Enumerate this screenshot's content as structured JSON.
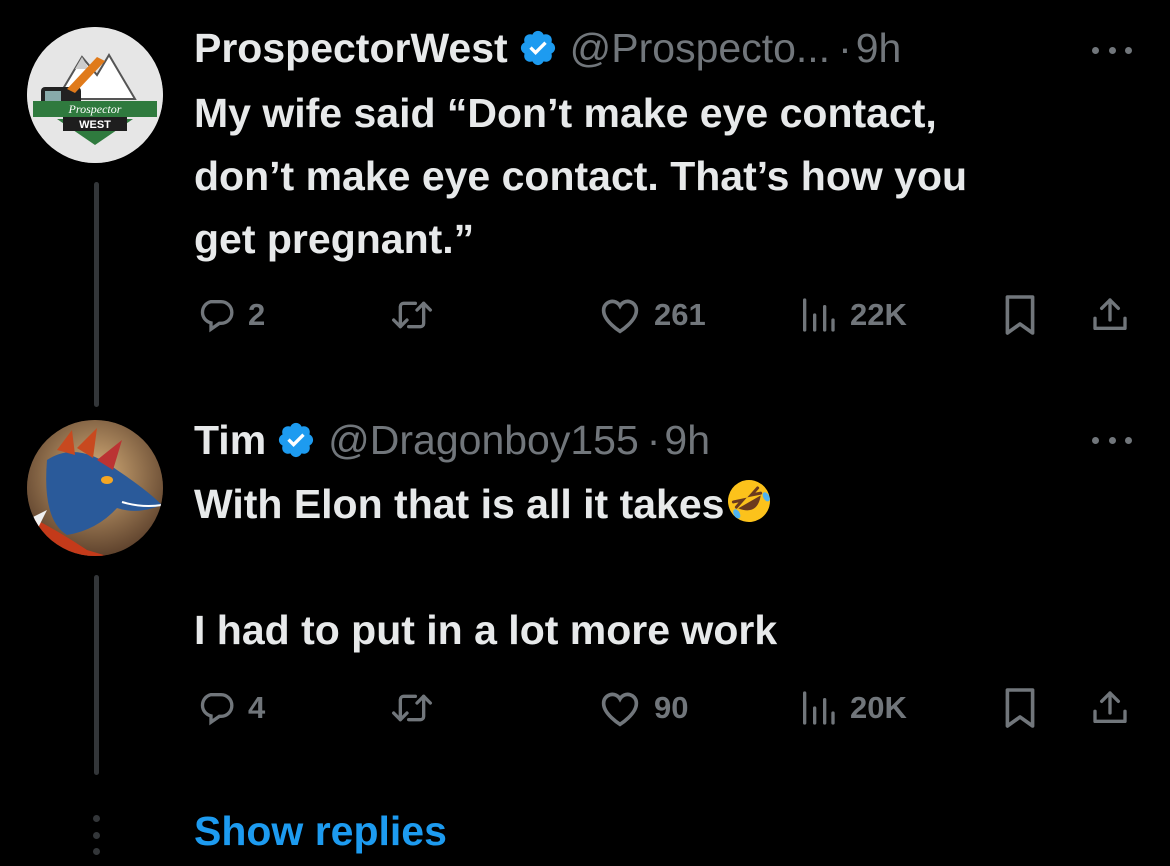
{
  "tweets": [
    {
      "display_name": "ProspectorWest",
      "handle": "@Prospecto...",
      "separator": "·",
      "time": "9h",
      "avatar_text": {
        "line1": "Prospector",
        "line2": "WEST"
      },
      "text_lines": [
        "My wife said “Don’t make eye contact,",
        "don’t make eye contact. That’s how you",
        "get pregnant.”"
      ],
      "replies": "2",
      "likes": "261",
      "views": "22K"
    },
    {
      "display_name": "Tim",
      "handle": "@Dragonboy155",
      "separator": "·",
      "time": "9h",
      "text_line1": "With Elon that is all it takes",
      "emoji": "rolling-on-floor-laughing",
      "text_line2": "I had to put in a lot more work",
      "replies": "4",
      "likes": "90",
      "views": "20K"
    }
  ],
  "show_replies_label": "Show replies",
  "colors": {
    "background": "#000000",
    "text": "#e7e9ea",
    "muted": "#71767b",
    "accent": "#1d9bf0",
    "thread_line": "#333639"
  }
}
